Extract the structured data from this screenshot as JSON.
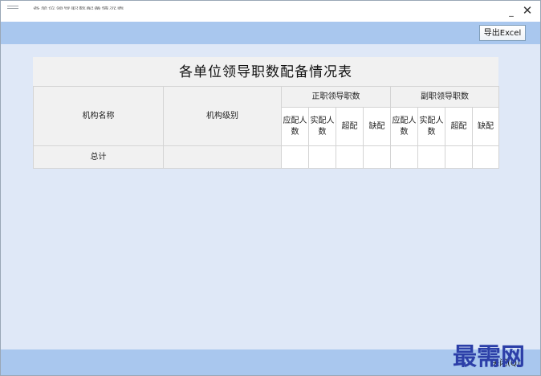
{
  "window": {
    "title": "各单位领导职数配备情况表",
    "minimize_label": "_",
    "close_label": "✕"
  },
  "toolbar": {
    "export_label": "导出Excel"
  },
  "report": {
    "title": "各单位领导职数配备情况表",
    "col_org_name": "机构名称",
    "col_org_level": "机构级别",
    "group_chief": "正职领导职数",
    "group_deputy": "副职领导职数",
    "sub_should": "应配人数",
    "sub_actual": "实配人数",
    "sub_over": "超配",
    "sub_lack": "缺配",
    "total_row": {
      "label": "总计",
      "level": "",
      "chief_should": "",
      "chief_actual": "",
      "chief_over": "",
      "chief_lack": "",
      "deputy_should": "",
      "deputy_actual": "",
      "deputy_over": "",
      "deputy_lack": ""
    }
  },
  "footer": {
    "close_label": "关闭(Q)"
  },
  "watermark": {
    "text": "最需网"
  }
}
